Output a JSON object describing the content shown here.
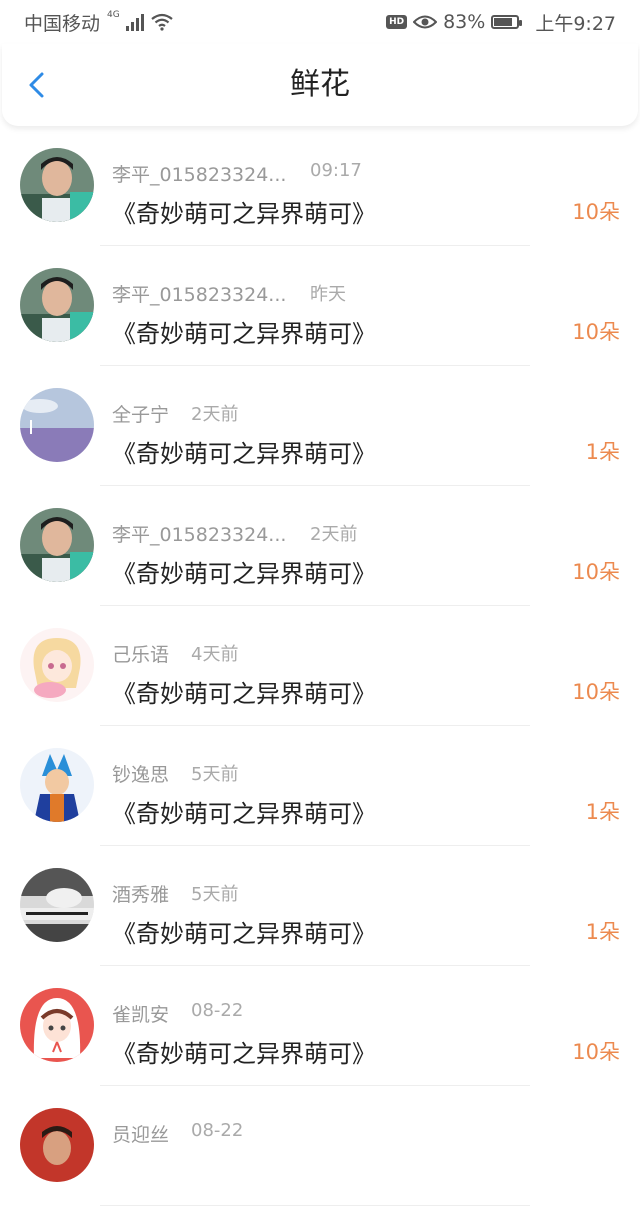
{
  "status": {
    "carrier": "中国移动",
    "network": "4G",
    "battery_pct": "83%",
    "battery_level": 0.83,
    "time": "上午9:27",
    "hd": "HD"
  },
  "header": {
    "title": "鲜花",
    "back_icon": "chevron-left-icon"
  },
  "colors": {
    "accent": "#2f8be6",
    "count": "#ec8a4f",
    "muted": "#999999"
  },
  "items": [
    {
      "name": "李平_015823324...",
      "time": "09:17",
      "book": "《奇妙萌可之异界萌可》",
      "count": "10朵",
      "avatar_icon": "user-photo-avatar"
    },
    {
      "name": "李平_015823324...",
      "time": "昨天",
      "book": "《奇妙萌可之异界萌可》",
      "count": "10朵",
      "avatar_icon": "user-photo-avatar"
    },
    {
      "name": "全子宁",
      "time": "2天前",
      "book": "《奇妙萌可之异界萌可》",
      "count": "1朵",
      "avatar_icon": "lavender-field-avatar"
    },
    {
      "name": "李平_015823324...",
      "time": "2天前",
      "book": "《奇妙萌可之异界萌可》",
      "count": "10朵",
      "avatar_icon": "user-photo-avatar"
    },
    {
      "name": "己乐语",
      "time": "4天前",
      "book": "《奇妙萌可之异界萌可》",
      "count": "10朵",
      "avatar_icon": "anime-girl-avatar"
    },
    {
      "name": "钞逸思",
      "time": "5天前",
      "book": "《奇妙萌可之异界萌可》",
      "count": "1朵",
      "avatar_icon": "anime-hero-avatar"
    },
    {
      "name": "酒秀雅",
      "time": "5天前",
      "book": "《奇妙萌可之异界萌可》",
      "count": "1朵",
      "avatar_icon": "bw-photo-avatar"
    },
    {
      "name": "雀凯安",
      "time": "08-22",
      "book": "《奇妙萌可之异界萌可》",
      "count": "10朵",
      "avatar_icon": "cartoon-girl-avatar"
    },
    {
      "name": "员迎丝",
      "time": "08-22",
      "book": "",
      "count": "",
      "avatar_icon": "red-photo-avatar"
    }
  ]
}
